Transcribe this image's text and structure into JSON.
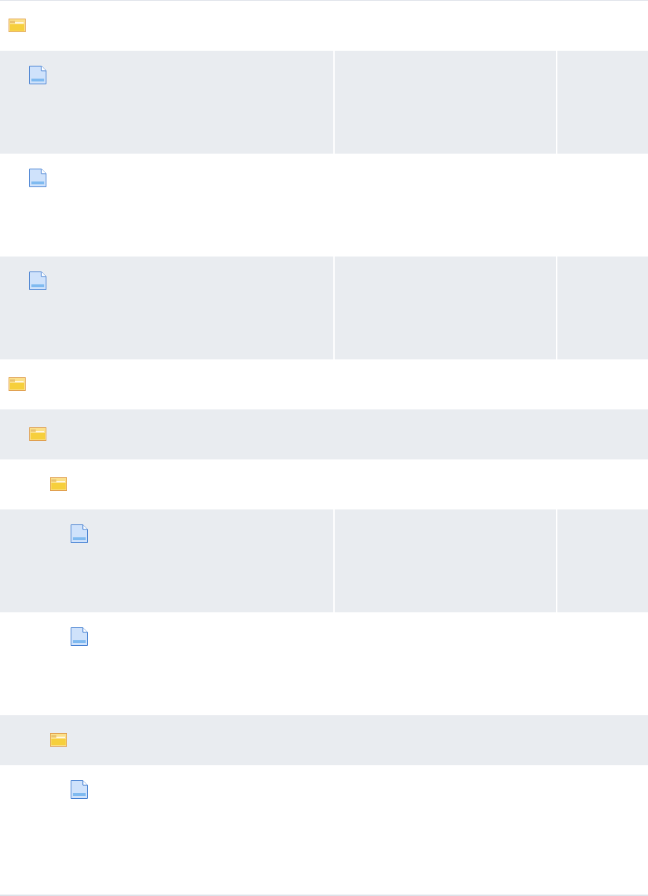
{
  "tree": [
    {
      "kind": "folder",
      "children": [
        {
          "kind": "file"
        },
        {
          "kind": "file"
        },
        {
          "kind": "file"
        }
      ]
    },
    {
      "kind": "folder",
      "children": [
        {
          "kind": "folder",
          "children": [
            {
              "kind": "folder",
              "children": [
                {
                  "kind": "file"
                },
                {
                  "kind": "file"
                }
              ]
            },
            {
              "kind": "folder",
              "children": [
                {
                  "kind": "file"
                }
              ]
            }
          ]
        }
      ]
    }
  ]
}
